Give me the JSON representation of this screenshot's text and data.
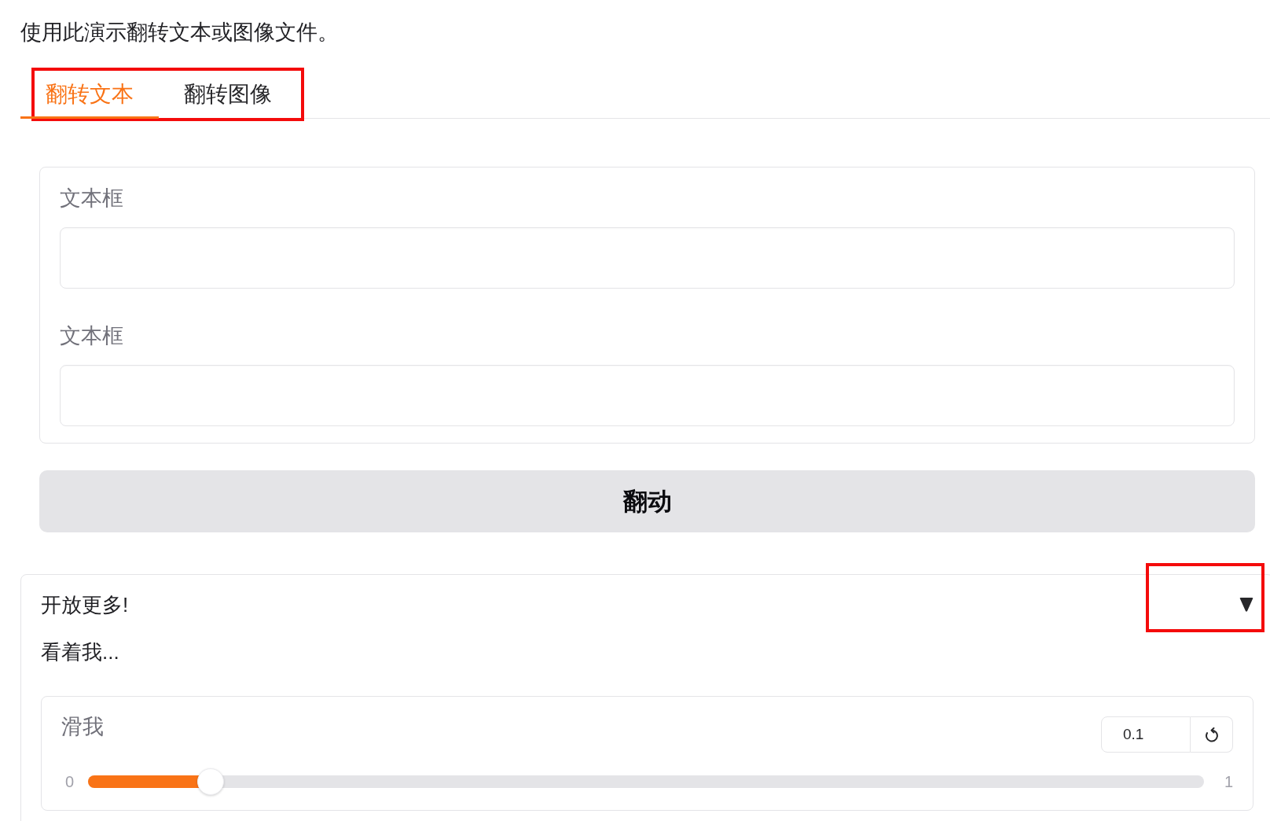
{
  "description": "使用此演示翻转文本或图像文件。",
  "tabs": {
    "highlighted": true,
    "items": [
      {
        "label": "翻转文本",
        "selected": true
      },
      {
        "label": "翻转图像",
        "selected": false
      }
    ]
  },
  "text_panel": {
    "fields": [
      {
        "label": "文本框"
      },
      {
        "label": "文本框"
      }
    ]
  },
  "flip_button": {
    "label": "翻动"
  },
  "accordion": {
    "title": "开放更多!",
    "expanded": true,
    "toggle_highlighted": true,
    "text": "看着我...",
    "slider": {
      "label": "滑我",
      "value": "0.1",
      "min_label": "0",
      "max_label": "1",
      "level": 0.1
    }
  }
}
